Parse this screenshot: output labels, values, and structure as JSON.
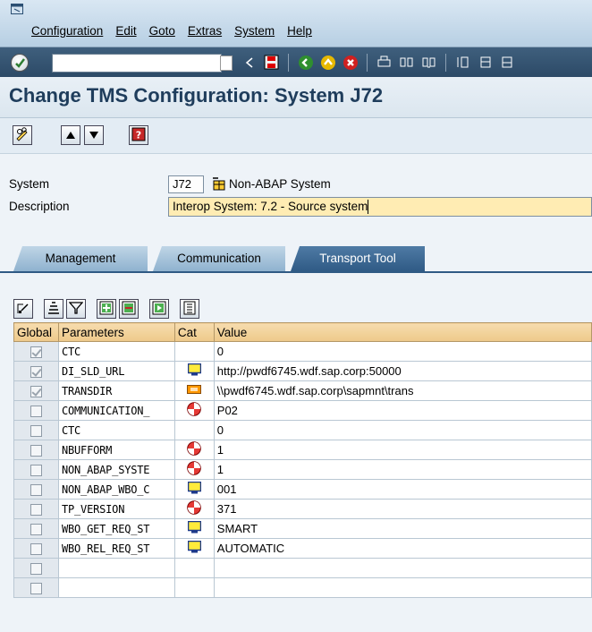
{
  "menubar": {
    "items": [
      "Configuration",
      "Edit",
      "Goto",
      "Extras",
      "System",
      "Help"
    ]
  },
  "stdbar": {
    "command_value": ""
  },
  "title": "Change TMS Configuration: System J72",
  "form": {
    "system_label": "System",
    "system_value": "J72",
    "system_type": "Non-ABAP System",
    "description_label": "Description",
    "description_value": "Interop System: 7.2 - Source system"
  },
  "tabs": [
    {
      "label": "Management",
      "active": false
    },
    {
      "label": "Communication",
      "active": false
    },
    {
      "label": "Transport Tool",
      "active": true
    }
  ],
  "table": {
    "headers": [
      "Global",
      "Parameters",
      "Cat",
      "Value"
    ],
    "rows": [
      {
        "global": true,
        "param": "CTC",
        "cat": "",
        "value": "0"
      },
      {
        "global": true,
        "param": "DI_SLD_URL",
        "cat": "monitor",
        "value": "http://pwdf6745.wdf.sap.corp:50000"
      },
      {
        "global": true,
        "param": "TRANSDIR",
        "cat": "bar",
        "value": "\\\\pwdf6745.wdf.sap.corp\\sapmnt\\trans"
      },
      {
        "global": false,
        "param": "COMMUNICATION_",
        "cat": "ball",
        "value": "P02"
      },
      {
        "global": false,
        "param": "CTC",
        "cat": "",
        "value": "0"
      },
      {
        "global": false,
        "param": "NBUFFORM",
        "cat": "ball",
        "value": "1"
      },
      {
        "global": false,
        "param": "NON_ABAP_SYSTE",
        "cat": "ball",
        "value": "1"
      },
      {
        "global": false,
        "param": "NON_ABAP_WBO_C",
        "cat": "monitor",
        "value": "001"
      },
      {
        "global": false,
        "param": "TP_VERSION",
        "cat": "ball",
        "value": "371"
      },
      {
        "global": false,
        "param": "WBO_GET_REQ_ST",
        "cat": "monitor",
        "value": "SMART"
      },
      {
        "global": false,
        "param": "WBO_REL_REQ_ST",
        "cat": "monitor",
        "value": "AUTOMATIC"
      },
      {
        "global": false,
        "param": "",
        "cat": "",
        "value": ""
      },
      {
        "global": false,
        "param": "",
        "cat": "",
        "value": ""
      }
    ]
  },
  "colors": {
    "title": "#1f3d5c",
    "header_bg": "#eec98a",
    "description_bg": "#ffecb3",
    "active_tab": "#2f5a85"
  }
}
